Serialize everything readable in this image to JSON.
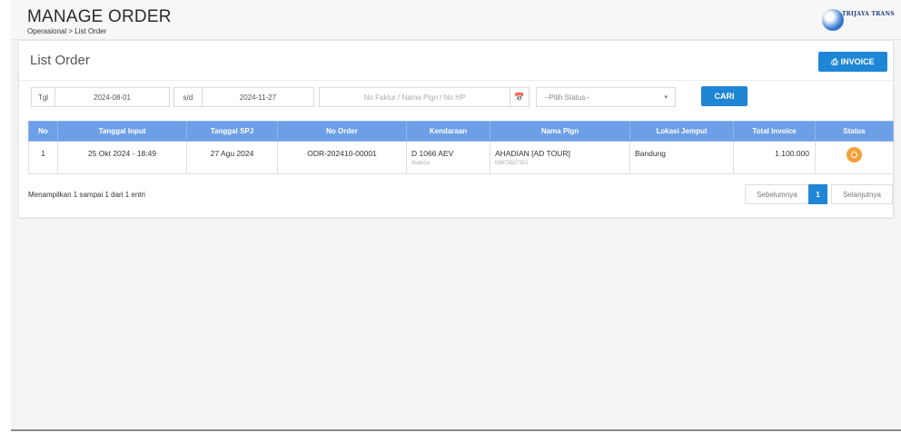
{
  "header": {
    "title": "MANAGE ORDER",
    "breadcrumb": [
      "Operasional",
      "List Order"
    ],
    "breadcrumb_sep": " > ",
    "logo_text": "TRIJAYA TRANS"
  },
  "card": {
    "title": "List Order",
    "invoice_button": "INVOICE"
  },
  "filters": {
    "date_label": "Tgl",
    "date_from": "2024-08-01",
    "date_sep": "s/d",
    "date_to": "2024-11-27",
    "search_placeholder": "No Faktur / Nama Pign / No HP",
    "status_placeholder": "--Pilih Status--",
    "search_button": "CARI"
  },
  "table": {
    "columns": [
      "No",
      "Tanggal Input",
      "Tanggal SPJ",
      "No Order",
      "Kendaraan",
      "Nama Plgn",
      "Lokasi Jemput",
      "Total Invoice",
      "Status"
    ],
    "rows": [
      {
        "no": "1",
        "tanggal_input": "25 Okt 2024 - 18:49",
        "tanggal_spj": "27 Agu 2024",
        "no_order": "ODR-202410-00001",
        "kendaraan": "D 1066 AEV",
        "kendaraan_sub": "Avanza",
        "nama_plgn": "AHADIAN [AD TOUR]",
        "nama_plgn_sub": "08873827321",
        "lokasi_jemput": "Bandung",
        "total_invoice": "1.100.000",
        "status_color": "#f2a13a"
      }
    ]
  },
  "footer": {
    "info": "Menampilkan 1 sampai 1 dari 1 entri",
    "prev": "Sebelumnya",
    "page": "1",
    "next": "Selanjutnya"
  },
  "colors": {
    "accent": "#1f86d6",
    "table_header": "#6d9fe7",
    "status_pending": "#f2a13a"
  }
}
